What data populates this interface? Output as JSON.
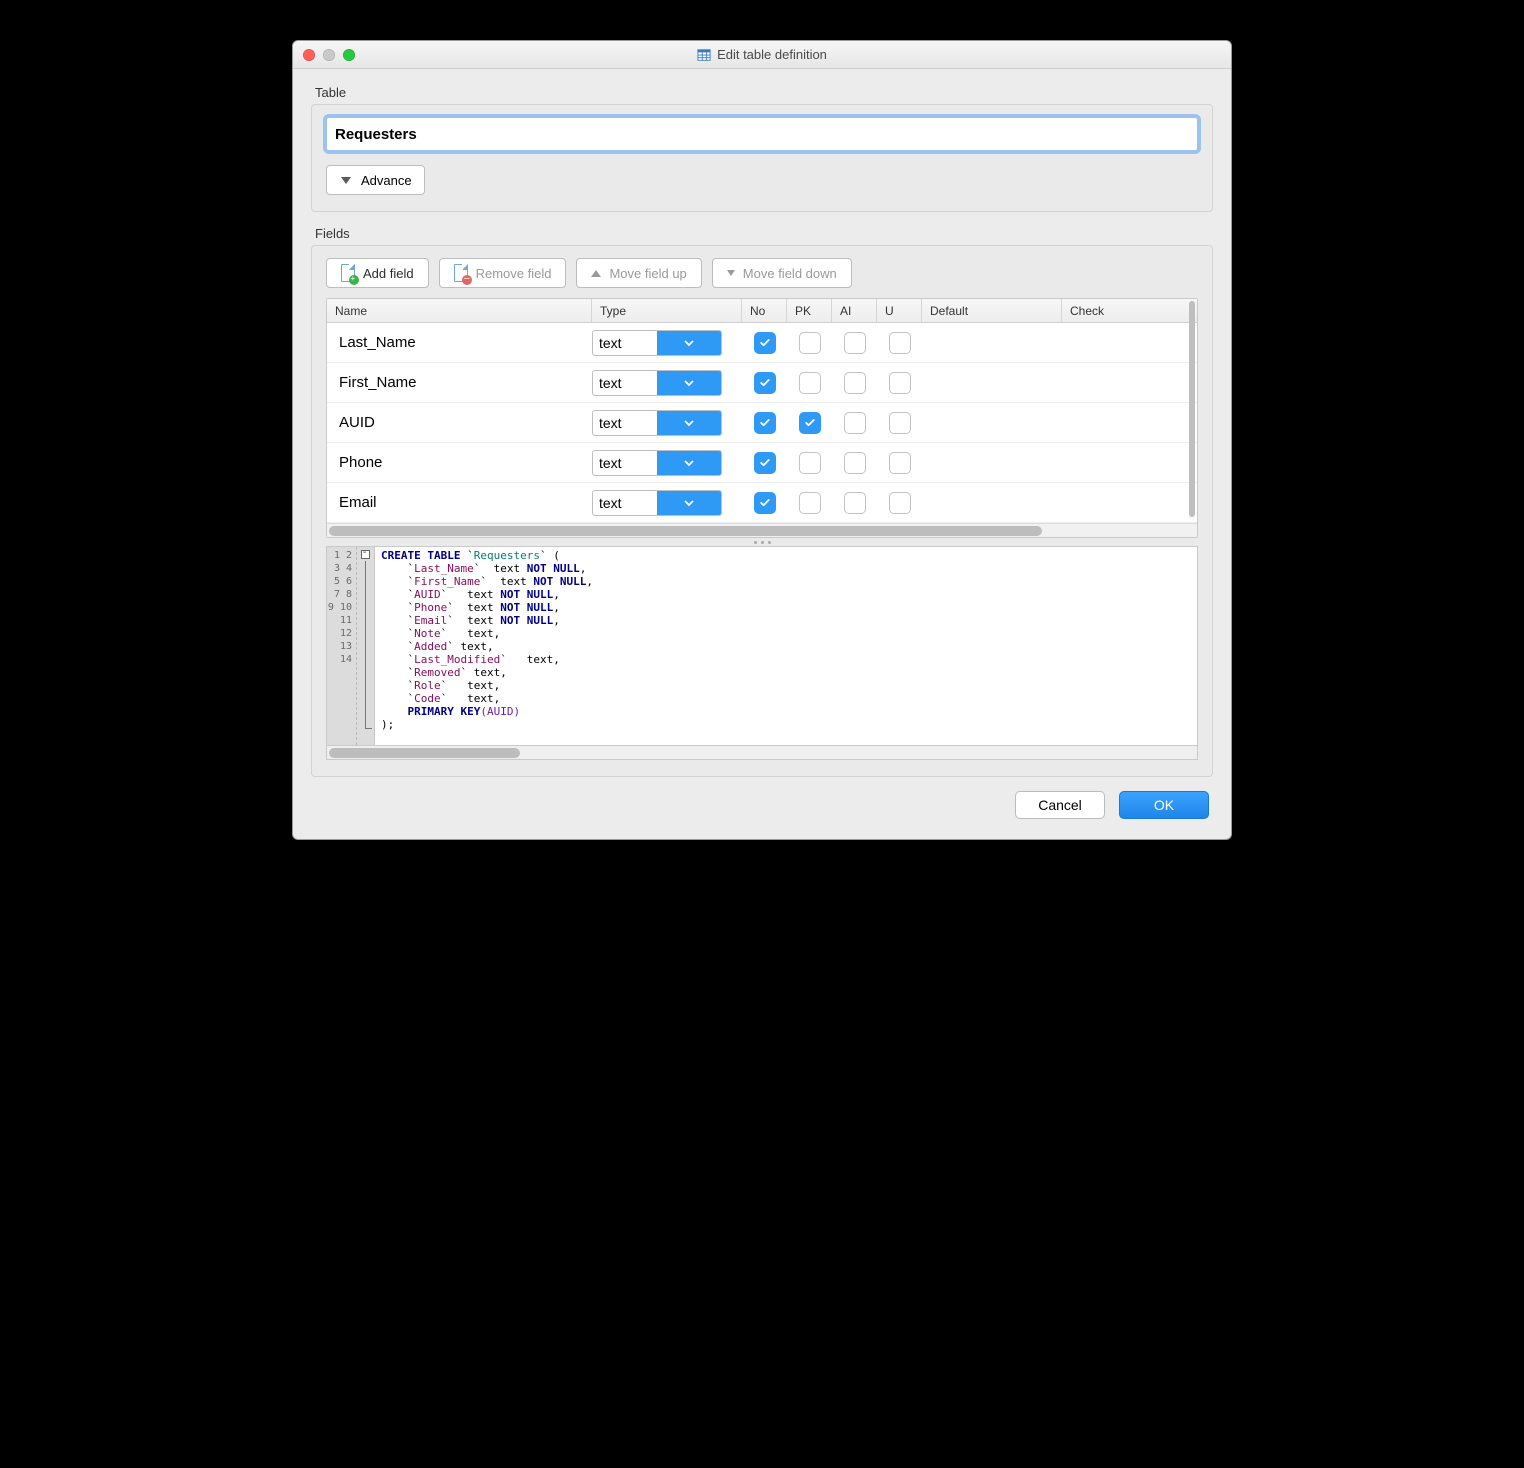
{
  "window": {
    "title": "Edit table definition"
  },
  "table_section": {
    "label": "Table",
    "name_value": "Requesters",
    "advance_label": "Advance"
  },
  "fields_section": {
    "label": "Fields",
    "toolbar": {
      "add": "Add field",
      "remove": "Remove field",
      "move_up": "Move field up",
      "move_down": "Move field down"
    },
    "columns": {
      "name": "Name",
      "type": "Type",
      "not_null": "No",
      "pk": "PK",
      "ai": "AI",
      "u": "U",
      "default": "Default",
      "check": "Check"
    },
    "rows": [
      {
        "name": "Last_Name",
        "type": "text",
        "nn": true,
        "pk": false,
        "ai": false,
        "u": false
      },
      {
        "name": "First_Name",
        "type": "text",
        "nn": true,
        "pk": false,
        "ai": false,
        "u": false
      },
      {
        "name": "AUID",
        "type": "text",
        "nn": true,
        "pk": true,
        "ai": false,
        "u": false
      },
      {
        "name": "Phone",
        "type": "text",
        "nn": true,
        "pk": false,
        "ai": false,
        "u": false
      },
      {
        "name": "Email",
        "type": "text",
        "nn": true,
        "pk": false,
        "ai": false,
        "u": false
      }
    ]
  },
  "sql": {
    "line_count": 14,
    "lines": [
      {
        "tokens": [
          [
            "kw",
            "CREATE TABLE"
          ],
          [
            "txt",
            " `"
          ],
          [
            "tbl",
            "Requesters"
          ],
          [
            "txt",
            "` ("
          ]
        ]
      },
      {
        "indent": 1,
        "tokens": [
          [
            "txt",
            "`"
          ],
          [
            "id",
            "Last_Name"
          ],
          [
            "txt",
            "`  text "
          ],
          [
            "kw",
            "NOT NULL"
          ],
          [
            "txt",
            ","
          ]
        ]
      },
      {
        "indent": 1,
        "tokens": [
          [
            "txt",
            "`"
          ],
          [
            "id",
            "First_Name"
          ],
          [
            "txt",
            "`  text "
          ],
          [
            "kw",
            "NOT NULL"
          ],
          [
            "txt",
            ","
          ]
        ]
      },
      {
        "indent": 1,
        "tokens": [
          [
            "txt",
            "`"
          ],
          [
            "id",
            "AUID"
          ],
          [
            "txt",
            "`   text "
          ],
          [
            "kw",
            "NOT NULL"
          ],
          [
            "txt",
            ","
          ]
        ]
      },
      {
        "indent": 1,
        "tokens": [
          [
            "txt",
            "`"
          ],
          [
            "id",
            "Phone"
          ],
          [
            "txt",
            "`  text "
          ],
          [
            "kw",
            "NOT NULL"
          ],
          [
            "txt",
            ","
          ]
        ]
      },
      {
        "indent": 1,
        "tokens": [
          [
            "txt",
            "`"
          ],
          [
            "id",
            "Email"
          ],
          [
            "txt",
            "`  text "
          ],
          [
            "kw",
            "NOT NULL"
          ],
          [
            "txt",
            ","
          ]
        ]
      },
      {
        "indent": 1,
        "tokens": [
          [
            "txt",
            "`"
          ],
          [
            "id",
            "Note"
          ],
          [
            "txt",
            "`   text,"
          ]
        ]
      },
      {
        "indent": 1,
        "tokens": [
          [
            "txt",
            "`"
          ],
          [
            "id",
            "Added"
          ],
          [
            "txt",
            "` text,"
          ]
        ]
      },
      {
        "indent": 1,
        "tokens": [
          [
            "txt",
            "`"
          ],
          [
            "id",
            "Last_Modified"
          ],
          [
            "txt",
            "`   text,"
          ]
        ]
      },
      {
        "indent": 1,
        "tokens": [
          [
            "txt",
            "`"
          ],
          [
            "id",
            "Removed"
          ],
          [
            "txt",
            "` text,"
          ]
        ]
      },
      {
        "indent": 1,
        "tokens": [
          [
            "txt",
            "`"
          ],
          [
            "id",
            "Role"
          ],
          [
            "txt",
            "`   text,"
          ]
        ]
      },
      {
        "indent": 1,
        "tokens": [
          [
            "txt",
            "`"
          ],
          [
            "id",
            "Code"
          ],
          [
            "txt",
            "`   text,"
          ]
        ]
      },
      {
        "indent": 1,
        "tokens": [
          [
            "kw",
            "PRIMARY KEY"
          ],
          [
            "fn",
            "(AUID)"
          ]
        ]
      },
      {
        "tokens": [
          [
            "txt",
            ");"
          ]
        ]
      }
    ]
  },
  "footer": {
    "cancel": "Cancel",
    "ok": "OK"
  }
}
